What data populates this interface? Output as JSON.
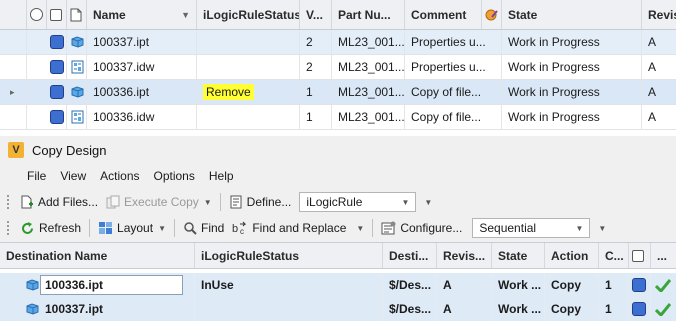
{
  "vault_grid": {
    "columns": [
      "Name",
      "iLogicRuleStatus",
      "V...",
      "Part Nu...",
      "Comment",
      "State",
      "Revisi"
    ],
    "rows": [
      {
        "name": "100337.ipt",
        "rule_status": "",
        "version": "2",
        "part_number": "ML23_001...",
        "comment": "Properties u...",
        "state": "Work in Progress",
        "revision": "A"
      },
      {
        "name": "100337.idw",
        "rule_status": "",
        "version": "2",
        "part_number": "ML23_001...",
        "comment": "Properties u...",
        "state": "Work in Progress",
        "revision": "A"
      },
      {
        "name": "100336.ipt",
        "rule_status": "Remove",
        "version": "1",
        "part_number": "ML23_001...",
        "comment": "Copy of file...",
        "state": "Work in Progress",
        "revision": "A"
      },
      {
        "name": "100336.idw",
        "rule_status": "",
        "version": "1",
        "part_number": "ML23_001...",
        "comment": "Copy of file...",
        "state": "Work in Progress",
        "revision": "A"
      }
    ]
  },
  "copy_design": {
    "title": "Copy Design",
    "logo_letter": "V",
    "menu": [
      "File",
      "View",
      "Actions",
      "Options",
      "Help"
    ],
    "toolbar1": {
      "add_files": "Add Files...",
      "execute_copy": "Execute Copy",
      "define": "Define...",
      "rule_combo": "iLogicRule"
    },
    "toolbar2": {
      "refresh": "Refresh",
      "layout": "Layout",
      "find": "Find",
      "find_replace": "Find and Replace",
      "configure": "Configure...",
      "mode_combo": "Sequential"
    },
    "grid": {
      "columns": [
        "Destination Name",
        "iLogicRuleStatus",
        "Desti...",
        "Revis...",
        "State",
        "Action",
        "C...",
        "..."
      ],
      "rows": [
        {
          "name": "100336.ipt",
          "rule_status": "InUse",
          "destination": "$/Des...",
          "revision": "A",
          "state": "Work ...",
          "action": "Copy",
          "c": "1"
        },
        {
          "name": "100337.ipt",
          "rule_status": "",
          "destination": "$/Des...",
          "revision": "A",
          "state": "Work ...",
          "action": "Copy",
          "c": "1"
        }
      ]
    }
  },
  "icons": [
    "ipt-part-icon",
    "idw-drawing-icon",
    "status-square-icon",
    "checkmark-icon",
    "refresh-icon",
    "layout-icon",
    "find-icon",
    "find-replace-icon",
    "configure-icon",
    "add-files-icon",
    "execute-copy-icon",
    "define-icon"
  ],
  "colors": {
    "selection": "#e4eef9",
    "highlight": "#ffff33",
    "status_blue": "#3d6fd1",
    "check_green": "#3aa53a",
    "logo": "#f2b233"
  }
}
